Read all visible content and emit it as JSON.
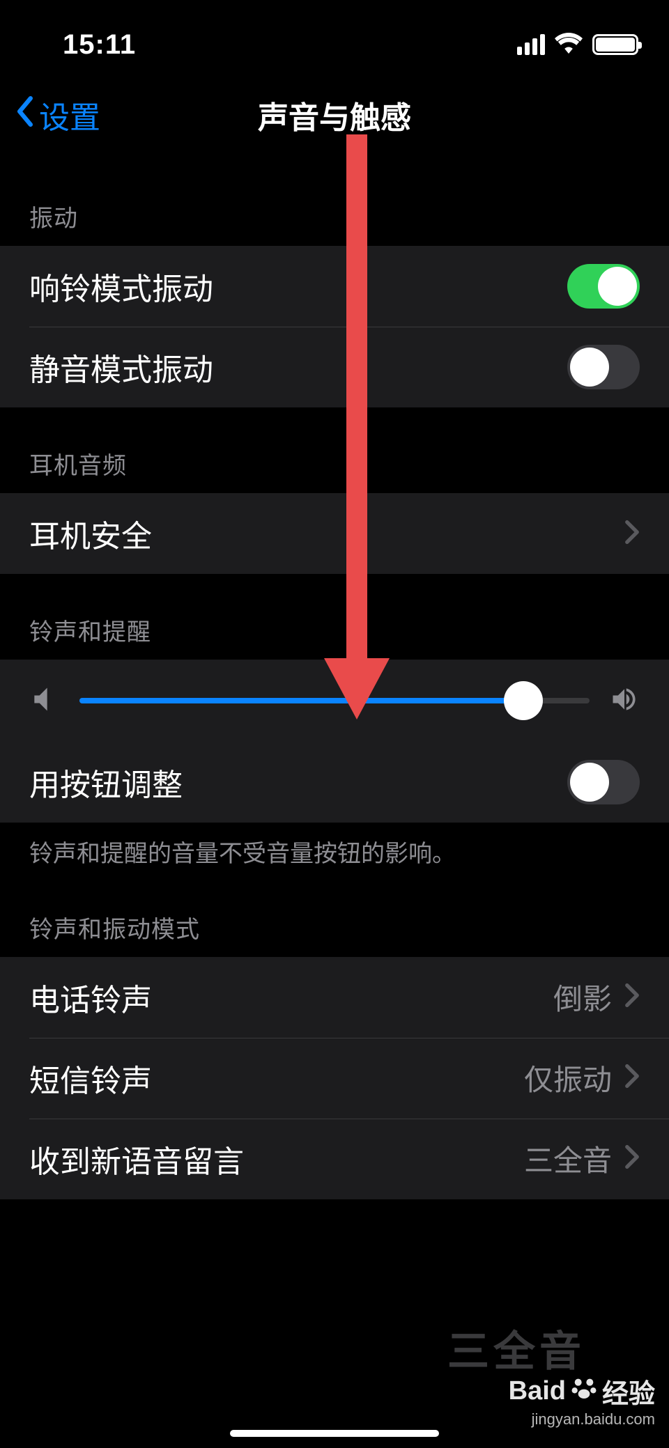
{
  "status": {
    "time": "15:11"
  },
  "nav": {
    "back": "设置",
    "title": "声音与触感"
  },
  "sections": {
    "vibration": {
      "header": "振动",
      "ring": {
        "label": "响铃模式振动",
        "on": true
      },
      "silent": {
        "label": "静音模式振动",
        "on": false
      }
    },
    "headphone": {
      "header": "耳机音频",
      "safety": {
        "label": "耳机安全"
      }
    },
    "ringer": {
      "header": "铃声和提醒",
      "slider_percent": 87,
      "change_with_buttons": {
        "label": "用按钮调整",
        "on": false
      },
      "footer": "铃声和提醒的音量不受音量按钮的影响。"
    },
    "sounds_patterns": {
      "header": "铃声和振动模式",
      "ringtone": {
        "label": "电话铃声",
        "value": "倒影"
      },
      "text_tone": {
        "label": "短信铃声",
        "value": "仅振动"
      },
      "voicemail": {
        "label": "收到新语音留言",
        "value": "三全音"
      }
    }
  },
  "watermark": {
    "bg": "三全音",
    "main": "Baid",
    "suffix": "经验",
    "sub": "jingyan.baidu.com"
  }
}
